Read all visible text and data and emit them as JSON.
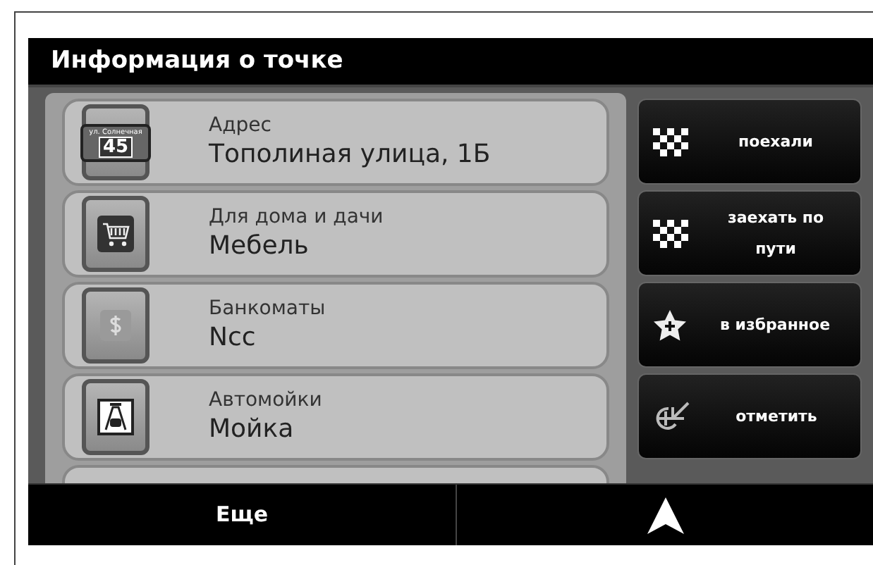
{
  "title": "Информация о точке",
  "items": [
    {
      "kind": "sign",
      "sign_top": "ул. Солнечная",
      "sign_number": "45",
      "label": "Адрес",
      "value": "Тополиная улица, 1Б"
    },
    {
      "kind": "cart",
      "label": "Для дома и дачи",
      "value": "Мебель"
    },
    {
      "kind": "dollar",
      "label": "Банкоматы",
      "value": "Ncc"
    },
    {
      "kind": "carwash",
      "label": "Автомойки",
      "value": "Мойка"
    }
  ],
  "actions": [
    {
      "kind": "flag",
      "label": "поехали"
    },
    {
      "kind": "flag",
      "label": "заехать по пути"
    },
    {
      "kind": "star",
      "label": "в избранное"
    },
    {
      "kind": "mark",
      "label": "отметить"
    }
  ],
  "bottom_bar": {
    "more": "Еще"
  }
}
